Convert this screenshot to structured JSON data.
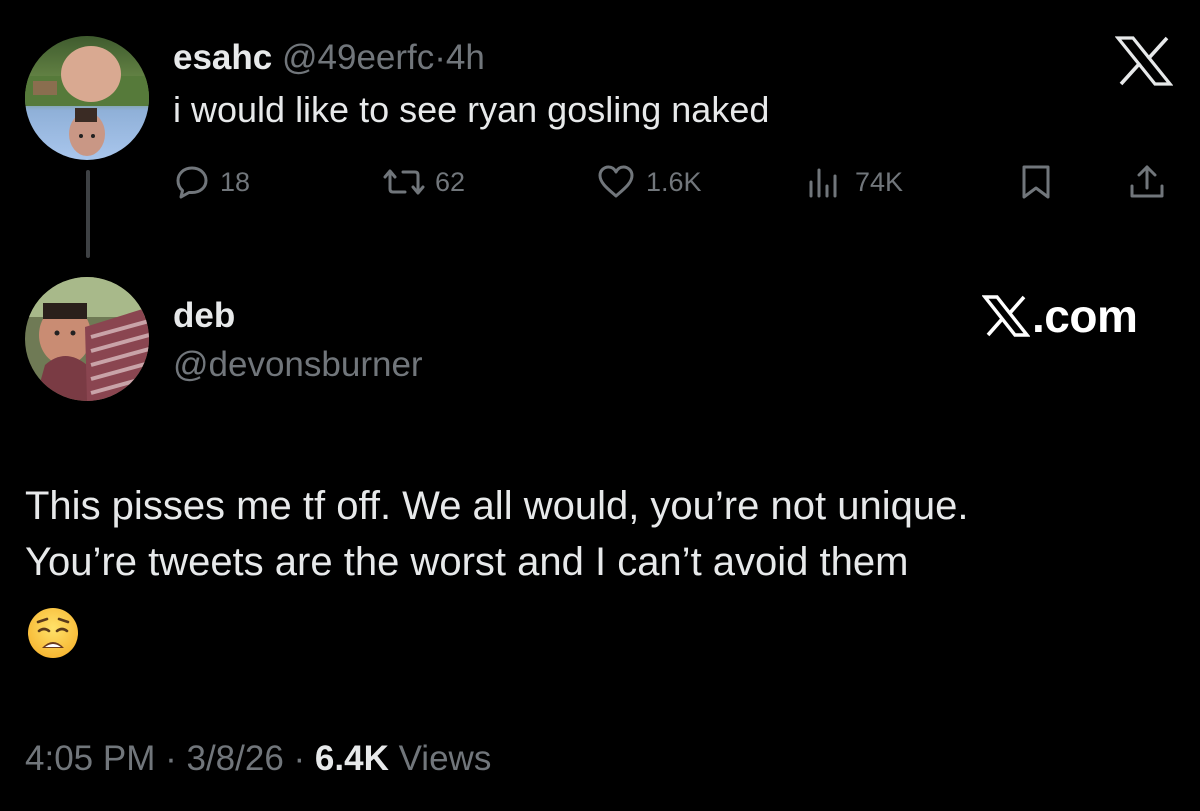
{
  "parent_tweet": {
    "display_name": "esahc",
    "handle": "@49eerfc",
    "separator": "·",
    "time_ago": "4h",
    "text": "i would like to see ryan gosling naked",
    "avatar_icon": "profile-photo",
    "actions": {
      "replies": {
        "icon": "comment-icon",
        "count": "18"
      },
      "reposts": {
        "icon": "repost-icon",
        "count": "62"
      },
      "likes": {
        "icon": "heart-icon",
        "count": "1.6K"
      },
      "views": {
        "icon": "analytics-icon",
        "count": "74K"
      },
      "bookmark": {
        "icon": "bookmark-icon"
      },
      "share": {
        "icon": "share-icon"
      }
    },
    "close_icon": "x-logo-icon"
  },
  "reply_tweet": {
    "display_name": "deb",
    "handle": "@devonsburner",
    "avatar_icon": "profile-photo",
    "brand": {
      "mark": "𝕏",
      "domain": ".com"
    },
    "text_line1": "This pisses me tf off. We all would, you’re not unique.",
    "text_line2": "You’re tweets are the worst and I can’t avoid them",
    "emoji": "weary-face-emoji",
    "footer": {
      "time": "4:05 PM",
      "separator": "·",
      "date": "3/8/26",
      "views_count": "6.4K",
      "views_label": "Views"
    }
  },
  "colors": {
    "background": "#000000",
    "primary_text": "#e7e9ea",
    "secondary_text": "#71767b",
    "thread_line": "#3e4144"
  }
}
